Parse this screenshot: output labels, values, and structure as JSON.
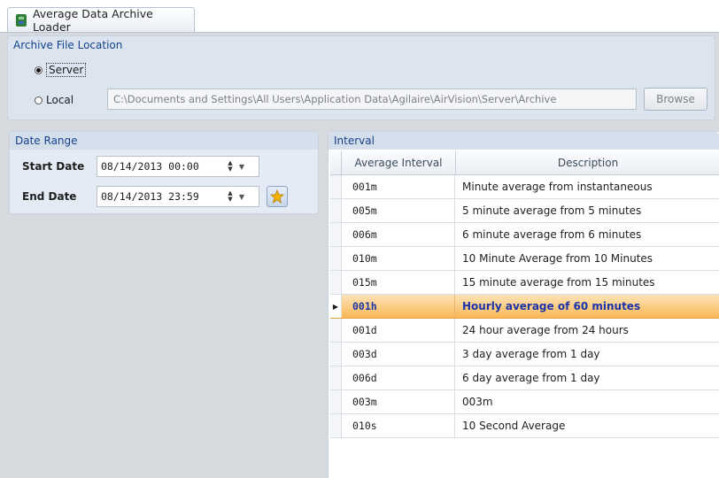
{
  "tab": {
    "title": "Average Data Archive Loader"
  },
  "archive": {
    "header": "Archive File Location",
    "server_label": "Server",
    "local_label": "Local",
    "selected": "Server",
    "path": "C:\\Documents and Settings\\All Users\\Application Data\\Agilaire\\AirVision\\Server\\Archive",
    "browse_label": "Browse"
  },
  "date_range": {
    "header": "Date Range",
    "start_label": "Start Date",
    "start_value": "08/14/2013  00:00",
    "end_label": "End Date",
    "end_value": "08/14/2013  23:59"
  },
  "interval": {
    "header": "Interval",
    "columns": [
      "Average Interval",
      "Description"
    ],
    "selected_index": 5,
    "rows": [
      {
        "code": "001m",
        "desc": "Minute average from instantaneous"
      },
      {
        "code": "005m",
        "desc": "5 minute average from 5 minutes"
      },
      {
        "code": "006m",
        "desc": "6 minute average from 6 minutes"
      },
      {
        "code": "010m",
        "desc": "10 Minute Average from 10 Minutes"
      },
      {
        "code": "015m",
        "desc": "15 minute average from 15 minutes"
      },
      {
        "code": "001h",
        "desc": "Hourly average of 60 minutes"
      },
      {
        "code": "001d",
        "desc": "24 hour average from 24 hours"
      },
      {
        "code": "003d",
        "desc": "3 day average from 1 day"
      },
      {
        "code": "006d",
        "desc": "6 day average from 1 day"
      },
      {
        "code": "003m",
        "desc": "003m"
      },
      {
        "code": "010s",
        "desc": "10 Second Average"
      }
    ]
  },
  "colors": {
    "header_text": "#15428b",
    "selected_row": "#f9b755",
    "selected_text": "#1a33a8"
  }
}
